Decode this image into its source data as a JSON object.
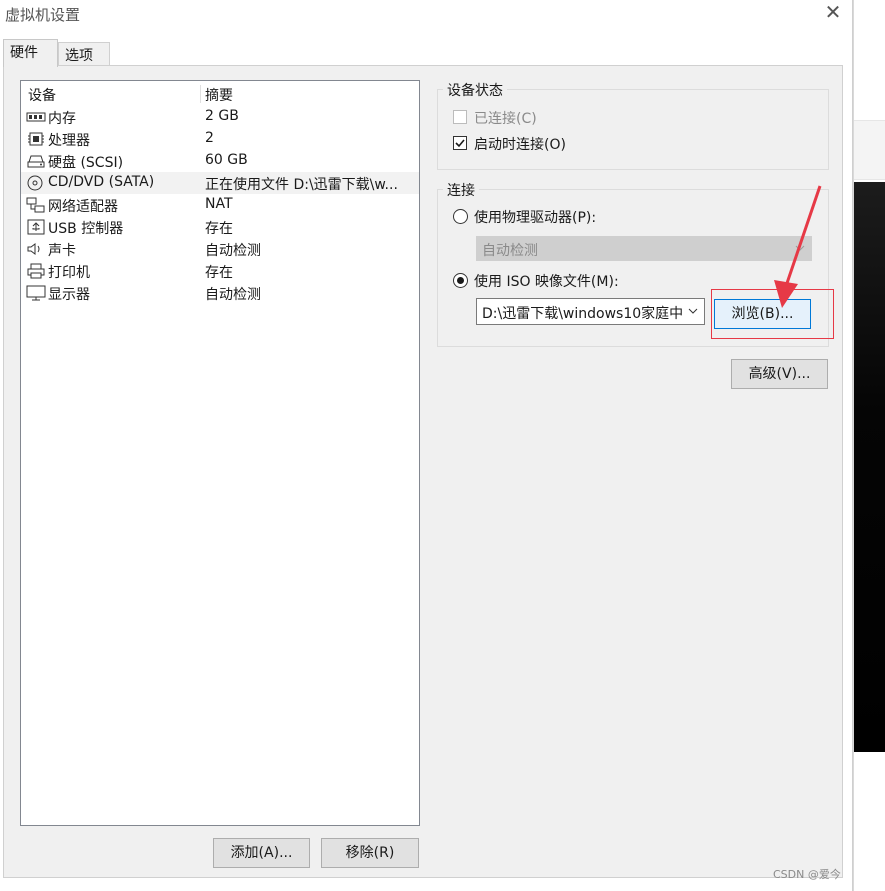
{
  "window": {
    "title": "虚拟机设置"
  },
  "tabs": [
    {
      "label": "硬件"
    },
    {
      "label": "选项"
    }
  ],
  "device_table": {
    "columns": [
      "设备",
      "摘要"
    ],
    "rows": [
      {
        "icon": "memory-icon",
        "device": "内存",
        "summary": "2 GB"
      },
      {
        "icon": "processor-icon",
        "device": "处理器",
        "summary": "2"
      },
      {
        "icon": "hard-disk-icon",
        "device": "硬盘 (SCSI)",
        "summary": "60 GB"
      },
      {
        "icon": "cd-dvd-icon",
        "device": "CD/DVD (SATA)",
        "summary": "正在使用文件 D:\\迅雷下载\\w...",
        "selected": true
      },
      {
        "icon": "network-adapter-icon",
        "device": "网络适配器",
        "summary": "NAT"
      },
      {
        "icon": "usb-icon",
        "device": "USB 控制器",
        "summary": "存在"
      },
      {
        "icon": "sound-card-icon",
        "device": "声卡",
        "summary": "自动检测"
      },
      {
        "icon": "printer-icon",
        "device": "打印机",
        "summary": "存在"
      },
      {
        "icon": "display-icon",
        "device": "显示器",
        "summary": "自动检测"
      }
    ]
  },
  "buttons": {
    "add": "添加(A)...",
    "remove": "移除(R)",
    "browse": "浏览(B)...",
    "advanced": "高级(V)..."
  },
  "device_status": {
    "title": "设备状态",
    "connected": {
      "label": "已连接(C)",
      "checked": false,
      "disabled": true
    },
    "connect_at_power_on": {
      "label": "启动时连接(O)",
      "checked": true
    }
  },
  "connection": {
    "title": "连接",
    "physical_drive": {
      "label": "使用物理驱动器(P):",
      "selected": false,
      "value": "自动检测"
    },
    "iso_image": {
      "label": "使用 ISO 映像文件(M):",
      "selected": true,
      "value": "D:\\迅雷下载\\windows10家庭中"
    }
  },
  "watermark": "CSDN @爱今",
  "colors": {
    "annotation": "#e63946",
    "selection": "#f2f2f2",
    "panel": "#f0f0f0"
  }
}
